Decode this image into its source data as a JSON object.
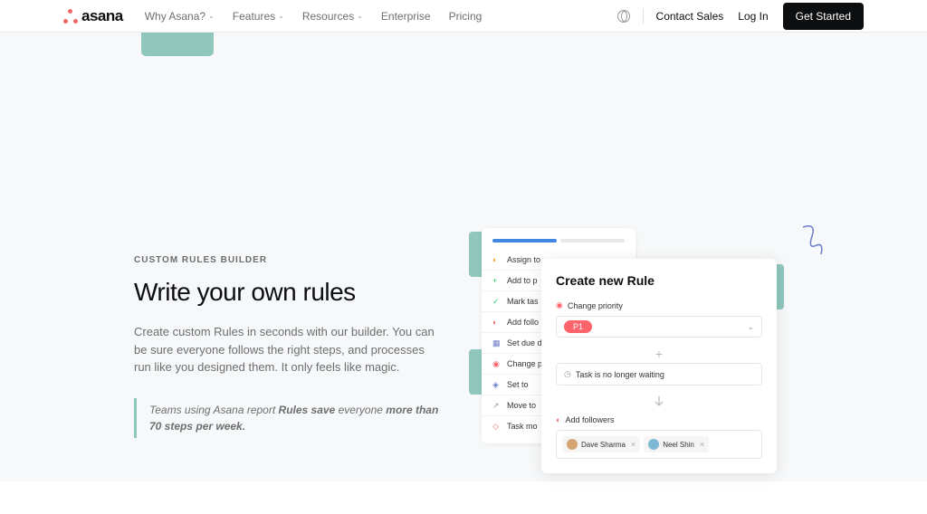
{
  "header": {
    "logo_text": "asana",
    "nav": [
      {
        "label": "Why Asana?",
        "dropdown": true
      },
      {
        "label": "Features",
        "dropdown": true
      },
      {
        "label": "Resources",
        "dropdown": true
      },
      {
        "label": "Enterprise",
        "dropdown": false
      },
      {
        "label": "Pricing",
        "dropdown": false
      }
    ],
    "contact": "Contact Sales",
    "login": "Log In",
    "cta": "Get Started"
  },
  "content": {
    "eyebrow": "CUSTOM RULES BUILDER",
    "heading": "Write your own rules",
    "body": "Create custom Rules in seconds with our builder. You can be sure everyone follows the right steps, and processes run like you designed them. It only feels like magic.",
    "quote_prefix": "Teams using Asana report ",
    "quote_bold1": "Rules save",
    "quote_mid": " everyone ",
    "quote_bold2": "more than 70 steps per week."
  },
  "back_panel": {
    "actions": [
      "Assign to",
      "Add to p",
      "Mark tas",
      "Add follo",
      "Set due d",
      "Change p",
      "Set to",
      "Move to",
      "Task mo"
    ]
  },
  "main_panel": {
    "title": "Create new Rule",
    "field1_label": "Change priority",
    "field1_value": "P1",
    "condition": "Task is no longer waiting",
    "followers_label": "Add followers",
    "chips": [
      "Dave Sharma",
      "Neel Shin"
    ]
  }
}
